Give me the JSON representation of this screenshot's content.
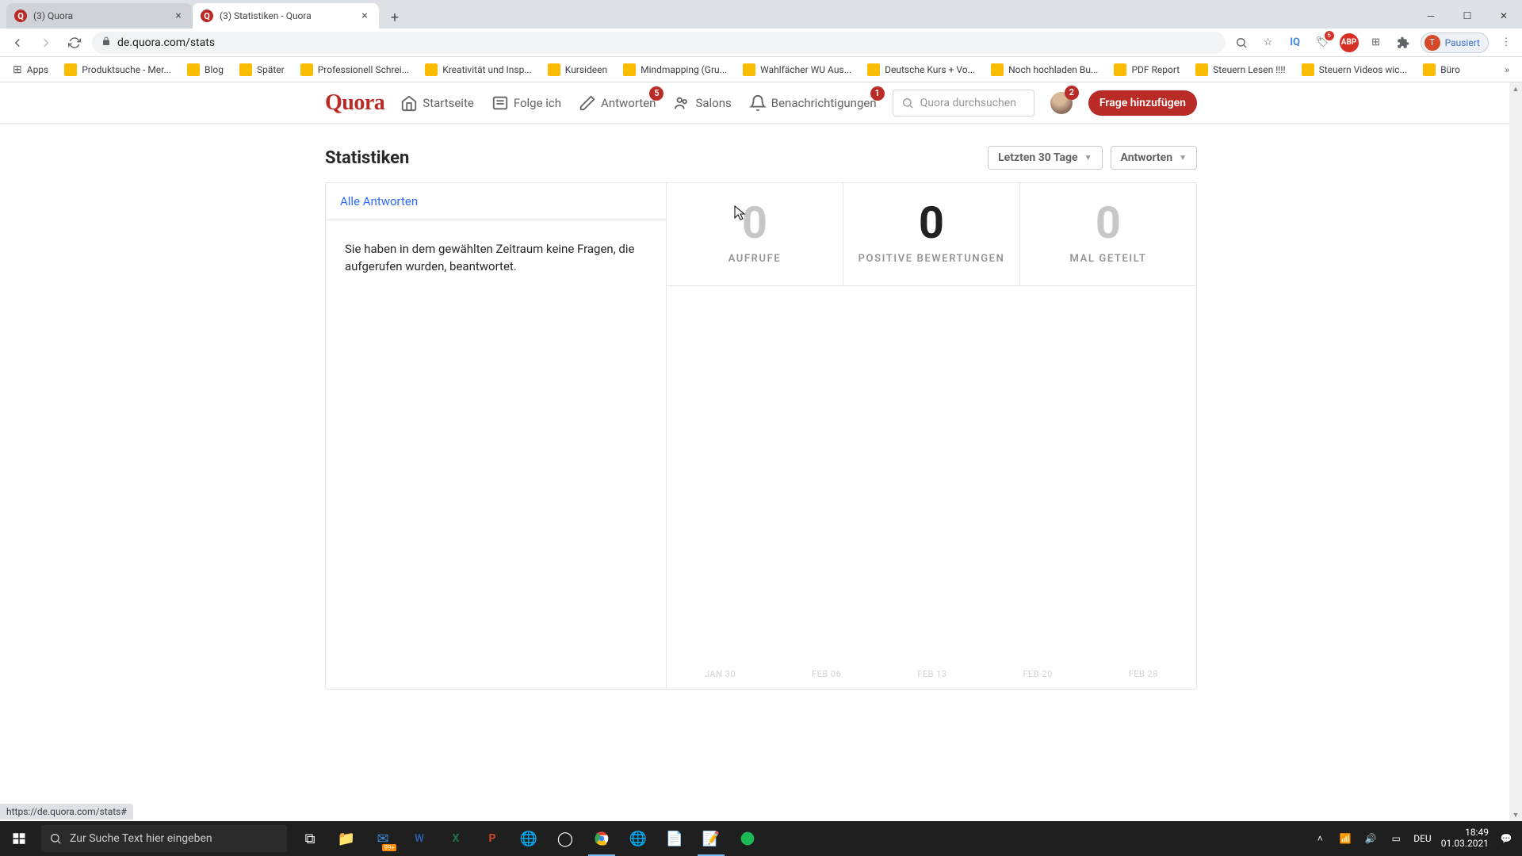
{
  "browser": {
    "tabs": [
      {
        "title": "(3) Quora",
        "active": false
      },
      {
        "title": "(3) Statistiken - Quora",
        "active": true
      }
    ],
    "url": "de.quora.com/stats",
    "profile_label": "Pausiert",
    "profile_initial": "T",
    "bookmarks": [
      "Apps",
      "Produktsuche - Mer...",
      "Blog",
      "Später",
      "Professionell Schrei...",
      "Kreativität und Insp...",
      "Kursideen",
      "Mindmapping  (Gru...",
      "Wahlfächer WU Aus...",
      "Deutsche Kurs + Vo...",
      "Noch hochladen Bu...",
      "PDF Report",
      "Steuern Lesen !!!!",
      "Steuern Videos wic...",
      "Büro"
    ]
  },
  "quora_nav": {
    "logo": "Quora",
    "items": [
      {
        "label": "Startseite",
        "badge": null
      },
      {
        "label": "Folge ich",
        "badge": null
      },
      {
        "label": "Antworten",
        "badge": "5"
      },
      {
        "label": "Salons",
        "badge": null
      },
      {
        "label": "Benachrichtigungen",
        "badge": "1"
      }
    ],
    "search_placeholder": "Quora durchsuchen",
    "avatar_badge": "2",
    "cta": "Frage hinzufügen"
  },
  "page": {
    "title": "Statistiken",
    "filters": {
      "range": "Letzten 30 Tage",
      "type": "Antworten"
    },
    "left": {
      "tab_label": "Alle Antworten",
      "empty_message": "Sie haben in dem gewählten Zeitraum keine Fragen, die aufgerufen wurden, beantwortet."
    },
    "metrics": [
      {
        "value": "0",
        "label": "AUFRUFE",
        "selected": false
      },
      {
        "value": "0",
        "label": "POSITIVE BEWERTUNGEN",
        "selected": true
      },
      {
        "value": "0",
        "label": "MAL GETEILT",
        "selected": false
      }
    ],
    "x_axis": [
      "JAN 30",
      "FEB 06",
      "FEB 13",
      "FEB 20",
      "FEB 28"
    ]
  },
  "status_bar": "https://de.quora.com/stats#",
  "taskbar": {
    "search_placeholder": "Zur Suche Text hier eingeben",
    "time": "18:49",
    "date": "01.03.2021",
    "lang": "DEU"
  },
  "chart_data": {
    "type": "bar",
    "categories": [
      "JAN 30",
      "FEB 06",
      "FEB 13",
      "FEB 20",
      "FEB 28"
    ],
    "series": [
      {
        "name": "Aufrufe",
        "values": [
          0,
          0,
          0,
          0,
          0
        ]
      },
      {
        "name": "Positive Bewertungen",
        "values": [
          0,
          0,
          0,
          0,
          0
        ]
      },
      {
        "name": "Mal geteilt",
        "values": [
          0,
          0,
          0,
          0,
          0
        ]
      }
    ],
    "title": "Statistiken – Letzten 30 Tage",
    "xlabel": "",
    "ylabel": "",
    "ylim": [
      0,
      1
    ]
  }
}
